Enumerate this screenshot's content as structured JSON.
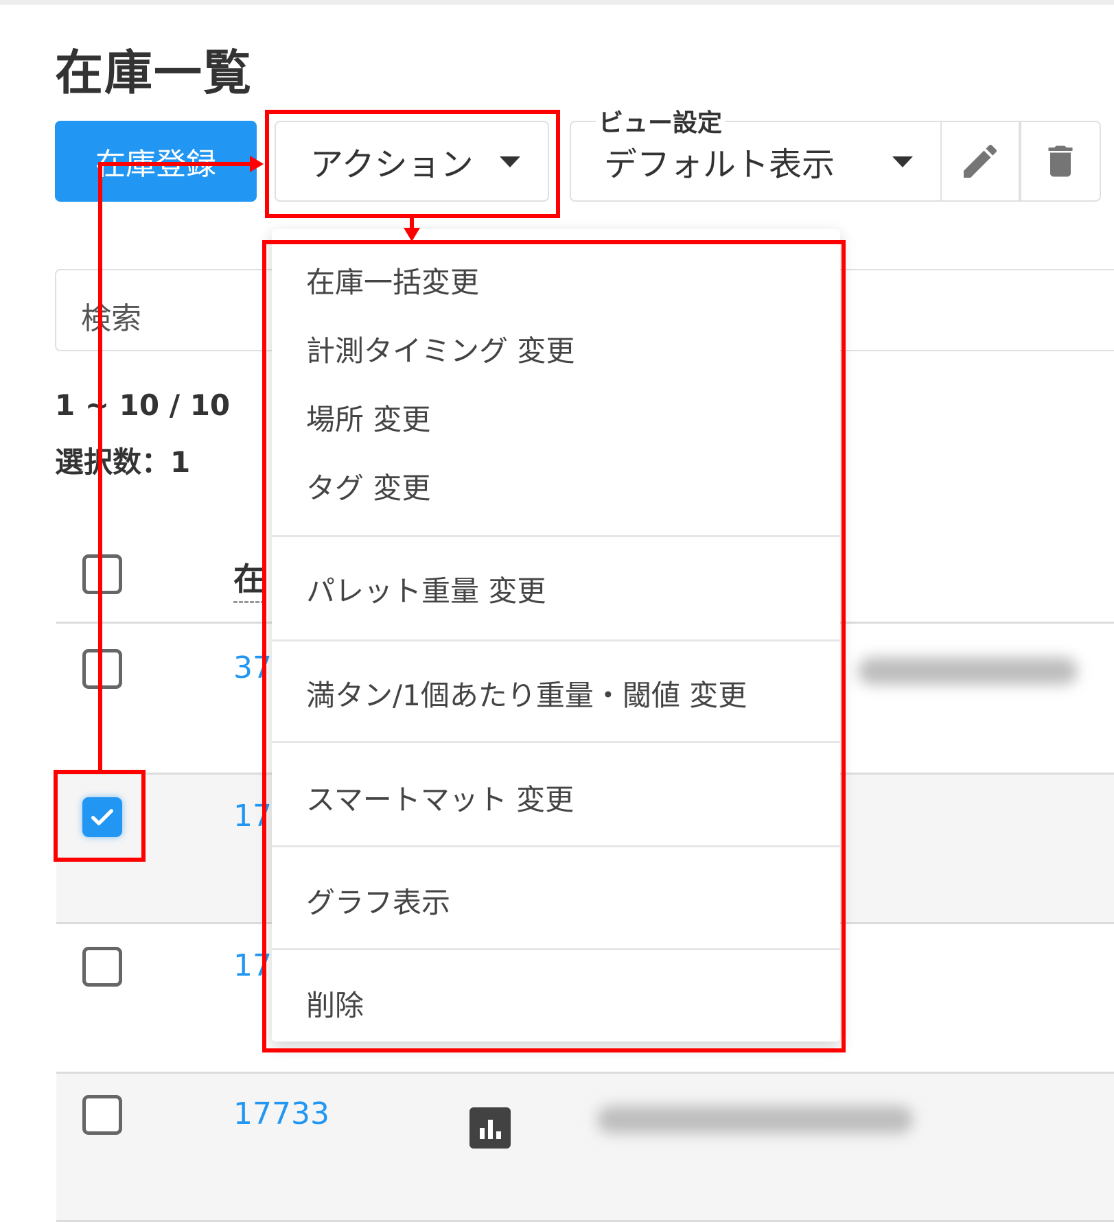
{
  "page": {
    "title": "在庫一覧"
  },
  "toolbar": {
    "register_label": "在庫登録",
    "action_label": "アクション",
    "view_settings_label": "ビュー設定",
    "view_selected": "デフォルト表示"
  },
  "search": {
    "placeholder": "検索"
  },
  "pagination": {
    "range": "1 ~ 10 / 10",
    "selected_count": "選択数：1"
  },
  "table": {
    "header_label": "在",
    "rows": [
      {
        "id": "37",
        "checked": false
      },
      {
        "id": "17",
        "checked": true
      },
      {
        "id": "17",
        "checked": false
      },
      {
        "id": "17733",
        "checked": false
      }
    ]
  },
  "action_menu": {
    "items": [
      "在庫一括変更",
      "計測タイミング 変更",
      "場所 変更",
      "タグ 変更",
      "パレット重量 変更",
      "満タン/1個あたり重量・閾値 変更",
      "スマートマット 変更",
      "グラフ表示",
      "削除"
    ]
  },
  "icons": {
    "caret": "caret-down-icon",
    "edit": "pencil-icon",
    "delete": "trash-icon",
    "chart": "bar-chart-icon",
    "check": "check-icon"
  },
  "colors": {
    "primary": "#2196f3",
    "annotation": "#ff0000",
    "link": "#2196f3"
  }
}
